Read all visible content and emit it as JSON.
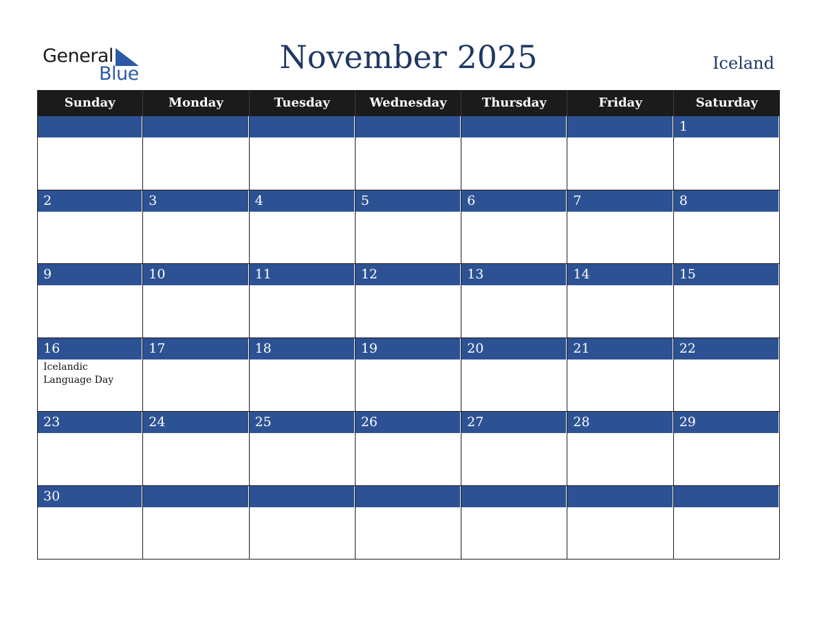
{
  "brand": {
    "line1": "General",
    "line2": "Blue",
    "accent": "#2b5aa6"
  },
  "title": "November 2025",
  "country": "Iceland",
  "colors": {
    "header_bg": "#1b1b1b",
    "day_bar": "#2d5294",
    "title": "#1f3864"
  },
  "weekdays": [
    "Sunday",
    "Monday",
    "Tuesday",
    "Wednesday",
    "Thursday",
    "Friday",
    "Saturday"
  ],
  "weeks": [
    [
      {
        "day": ""
      },
      {
        "day": ""
      },
      {
        "day": ""
      },
      {
        "day": ""
      },
      {
        "day": ""
      },
      {
        "day": ""
      },
      {
        "day": "1"
      }
    ],
    [
      {
        "day": "2"
      },
      {
        "day": "3"
      },
      {
        "day": "4"
      },
      {
        "day": "5"
      },
      {
        "day": "6"
      },
      {
        "day": "7"
      },
      {
        "day": "8"
      }
    ],
    [
      {
        "day": "9"
      },
      {
        "day": "10"
      },
      {
        "day": "11"
      },
      {
        "day": "12"
      },
      {
        "day": "13"
      },
      {
        "day": "14"
      },
      {
        "day": "15"
      }
    ],
    [
      {
        "day": "16",
        "event": "Icelandic Language Day"
      },
      {
        "day": "17"
      },
      {
        "day": "18"
      },
      {
        "day": "19"
      },
      {
        "day": "20"
      },
      {
        "day": "21"
      },
      {
        "day": "22"
      }
    ],
    [
      {
        "day": "23"
      },
      {
        "day": "24"
      },
      {
        "day": "25"
      },
      {
        "day": "26"
      },
      {
        "day": "27"
      },
      {
        "day": "28"
      },
      {
        "day": "29"
      }
    ],
    [
      {
        "day": "30"
      },
      {
        "day": ""
      },
      {
        "day": ""
      },
      {
        "day": ""
      },
      {
        "day": ""
      },
      {
        "day": ""
      },
      {
        "day": ""
      }
    ]
  ]
}
